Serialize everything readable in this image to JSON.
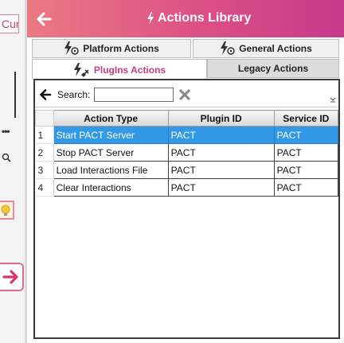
{
  "background": {
    "tab_label": "Cur"
  },
  "header": {
    "title": "Actions Library",
    "back_icon": "arrow-left-icon",
    "bolt_icon": "lightning-icon"
  },
  "tabs": [
    {
      "label": "Platform Actions",
      "active": false
    },
    {
      "label": "General Actions",
      "active": false
    },
    {
      "label": "PlugIns Actions",
      "active": true
    },
    {
      "label": "Legacy Actions",
      "active": false
    }
  ],
  "toolbar": {
    "search_label": "Search:",
    "search_value": ""
  },
  "grid": {
    "columns": [
      "Action Type",
      "Plugin ID",
      "Service ID"
    ],
    "rows": [
      {
        "num": "1",
        "action": "Start PACT Server",
        "plugin": "PACT",
        "service": "PACT",
        "selected": true
      },
      {
        "num": "2",
        "action": "Stop PACT Server",
        "plugin": "PACT",
        "service": "PACT",
        "selected": false
      },
      {
        "num": "3",
        "action": "Load Interactions File",
        "plugin": "PACT",
        "service": "PACT",
        "selected": false
      },
      {
        "num": "4",
        "action": "Clear Interactions",
        "plugin": "PACT",
        "service": "PACT",
        "selected": false
      }
    ]
  },
  "colors": {
    "header_start": "#eb7a83",
    "header_end": "#c7398a",
    "active_tab_text": "#c23f7d",
    "selection": "#3399e6"
  }
}
